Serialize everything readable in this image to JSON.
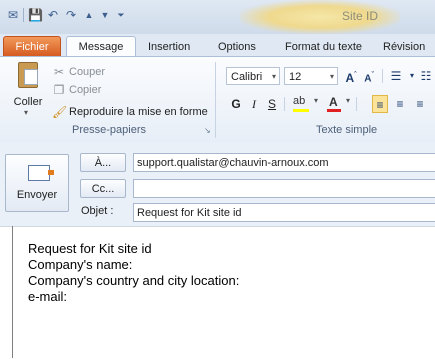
{
  "window": {
    "title": "Site ID"
  },
  "quick_access": {
    "items": [
      {
        "name": "outlook-app-icon",
        "glyph": "✉"
      },
      {
        "name": "save-icon",
        "glyph": "💾"
      },
      {
        "name": "undo-icon",
        "glyph": "↶"
      },
      {
        "name": "redo-icon",
        "glyph": "↷"
      },
      {
        "name": "up-arrow-icon",
        "glyph": "▲"
      },
      {
        "name": "down-arrow-icon",
        "glyph": "▼"
      },
      {
        "name": "customize-qat-icon",
        "glyph": "⏷"
      }
    ]
  },
  "tabs": {
    "file": "Fichier",
    "message": "Message",
    "insertion": "Insertion",
    "options": "Options",
    "format": "Format du texte",
    "revision": "Révision"
  },
  "clipboard": {
    "paste": "Coller",
    "cut": "Couper",
    "copy": "Copier",
    "format_painter": "Reproduire la mise en forme",
    "group_label": "Presse-papiers"
  },
  "basic_text": {
    "font_name": "Calibri",
    "font_size": "12",
    "bold": "G",
    "italic": "I",
    "underline": "S",
    "group_label": "Texte simple"
  },
  "compose": {
    "send_label": "Envoyer",
    "to_button": "À...",
    "cc_button": "Cc...",
    "subject_label": "Objet :",
    "to_value": "support.qualistar@chauvin-arnoux.com",
    "cc_value": "",
    "subject_value": "Request for Kit site id"
  },
  "body": {
    "lines": [
      "Request for Kit site id",
      "Company's name:",
      "Company's country and city location:",
      "e-mail:"
    ]
  },
  "colors": {
    "file_tab": "#d4581e",
    "ribbon_bg": "#e7eef7",
    "accent_blue": "#1d3c6b"
  }
}
